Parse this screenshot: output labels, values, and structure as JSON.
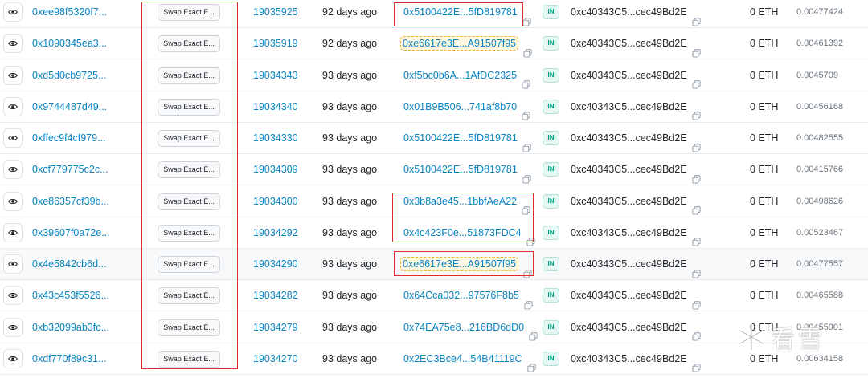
{
  "rows": [
    {
      "tx": "0xee98f5320f7...",
      "method": "Swap Exact E...",
      "block": "19035925",
      "age": "92 days ago",
      "from": "0x5100422E...5fD819781",
      "from_hl": false,
      "dir": "IN",
      "to": "0xc40343C5...cec49Bd2E",
      "value": "0 ETH",
      "fee": "0.00477424"
    },
    {
      "tx": "0x1090345ea3...",
      "method": "Swap Exact E...",
      "block": "19035919",
      "age": "92 days ago",
      "from": "0xe6617e3E...A91507f95",
      "from_hl": true,
      "dir": "IN",
      "to": "0xc40343C5...cec49Bd2E",
      "value": "0 ETH",
      "fee": "0.00461392"
    },
    {
      "tx": "0xd5d0cb9725...",
      "method": "Swap Exact E...",
      "block": "19034343",
      "age": "93 days ago",
      "from": "0xf5bc0b6A...1AfDC2325",
      "from_hl": false,
      "dir": "IN",
      "to": "0xc40343C5...cec49Bd2E",
      "value": "0 ETH",
      "fee": "0.0045709"
    },
    {
      "tx": "0x9744487d49...",
      "method": "Swap Exact E...",
      "block": "19034340",
      "age": "93 days ago",
      "from": "0x01B9B506...741af8b70",
      "from_hl": false,
      "dir": "IN",
      "to": "0xc40343C5...cec49Bd2E",
      "value": "0 ETH",
      "fee": "0.00456168"
    },
    {
      "tx": "0xffec9f4cf979...",
      "method": "Swap Exact E...",
      "block": "19034330",
      "age": "93 days ago",
      "from": "0x5100422E...5fD819781",
      "from_hl": false,
      "dir": "IN",
      "to": "0xc40343C5...cec49Bd2E",
      "value": "0 ETH",
      "fee": "0.00482555"
    },
    {
      "tx": "0xcf779775c2c...",
      "method": "Swap Exact E...",
      "block": "19034309",
      "age": "93 days ago",
      "from": "0x5100422E...5fD819781",
      "from_hl": false,
      "dir": "IN",
      "to": "0xc40343C5...cec49Bd2E",
      "value": "0 ETH",
      "fee": "0.00415766"
    },
    {
      "tx": "0xe86357cf39b...",
      "method": "Swap Exact E...",
      "block": "19034300",
      "age": "93 days ago",
      "from": "0x3b8a3e45...1bbfAeA22",
      "from_hl": false,
      "dir": "IN",
      "to": "0xc40343C5...cec49Bd2E",
      "value": "0 ETH",
      "fee": "0.00498626"
    },
    {
      "tx": "0x39607f0a72e...",
      "method": "Swap Exact E...",
      "block": "19034292",
      "age": "93 days ago",
      "from": "0x4c423F0e...51873FDC4",
      "from_hl": false,
      "dir": "IN",
      "to": "0xc40343C5...cec49Bd2E",
      "value": "0 ETH",
      "fee": "0.00523467"
    },
    {
      "tx": "0x4e5842cb6d...",
      "method": "Swap Exact E...",
      "block": "19034290",
      "age": "93 days ago",
      "from": "0xe6617e3E...A91507f95",
      "from_hl": true,
      "dir": "IN",
      "to": "0xc40343C5...cec49Bd2E",
      "value": "0 ETH",
      "fee": "0.00477557"
    },
    {
      "tx": "0x43c453f5526...",
      "method": "Swap Exact E...",
      "block": "19034282",
      "age": "93 days ago",
      "from": "0x64Cca032...97576F8b5",
      "from_hl": false,
      "dir": "IN",
      "to": "0xc40343C5...cec49Bd2E",
      "value": "0 ETH",
      "fee": "0.00465588"
    },
    {
      "tx": "0xb32099ab3fc...",
      "method": "Swap Exact E...",
      "block": "19034279",
      "age": "93 days ago",
      "from": "0x74EA75e8...216BD6dD0",
      "from_hl": false,
      "dir": "IN",
      "to": "0xc40343C5...cec49Bd2E",
      "value": "0 ETH",
      "fee": "0.00455901"
    },
    {
      "tx": "0xdf770f89c31...",
      "method": "Swap Exact E...",
      "block": "19034270",
      "age": "93 days ago",
      "from": "0x2EC3Bce4...54B41119C",
      "from_hl": false,
      "dir": "IN",
      "to": "0xc40343C5...cec49Bd2E",
      "value": "0 ETH",
      "fee": "0.00634158"
    }
  ],
  "watermark": {
    "text": "看雪"
  },
  "colors": {
    "link": "#0784c3",
    "annotation": "#d9302c",
    "in_badge": "#00a186"
  }
}
